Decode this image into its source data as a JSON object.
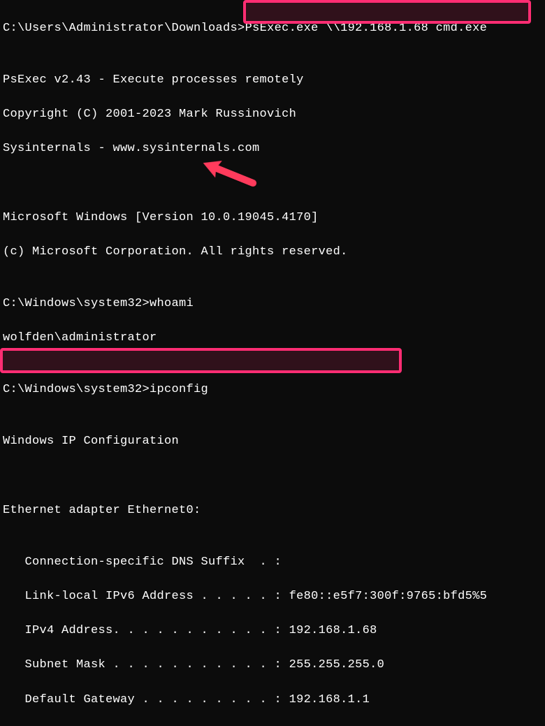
{
  "terminal": {
    "prompt1_path": "C:\\Users\\Administrator\\Downloads>",
    "prompt1_cmd": "PsExec.exe \\\\192.168.1.68 cmd.exe",
    "blank1": "",
    "psexec_line1": "PsExec v2.43 - Execute processes remotely",
    "psexec_line2": "Copyright (C) 2001-2023 Mark Russinovich",
    "psexec_line3": "Sysinternals - www.sysinternals.com",
    "blank2": "",
    "blank3": "",
    "win_ver": "Microsoft Windows [Version 10.0.19045.4170]",
    "win_copy": "(c) Microsoft Corporation. All rights reserved.",
    "blank4": "",
    "prompt2_path": "C:\\Windows\\system32>",
    "prompt2_cmd": "whoami",
    "whoami_out": "wolfden\\administrator",
    "blank5": "",
    "prompt3_path": "C:\\Windows\\system32>",
    "prompt3_cmd": "ipconfig",
    "blank6": "",
    "ipcfg_hdr": "Windows IP Configuration",
    "blank7": "",
    "blank8": "",
    "eth_hdr": "Ethernet adapter Ethernet0:",
    "blank9": "",
    "dns_suffix": "   Connection-specific DNS Suffix  . :",
    "ipv6": "   Link-local IPv6 Address . . . . . : fe80::e5f7:300f:9765:bfd5%5",
    "ipv4": "   IPv4 Address. . . . . . . . . . . : 192.168.1.68",
    "subnet": "   Subnet Mask . . . . . . . . . . . : 255.255.255.0",
    "gateway": "   Default Gateway . . . . . . . . . : 192.168.1.1"
  },
  "annotations": {
    "highlight_top": "psexec-command-highlight",
    "highlight_bottom": "ipv4-address-highlight",
    "arrow": "whoami-arrow"
  }
}
